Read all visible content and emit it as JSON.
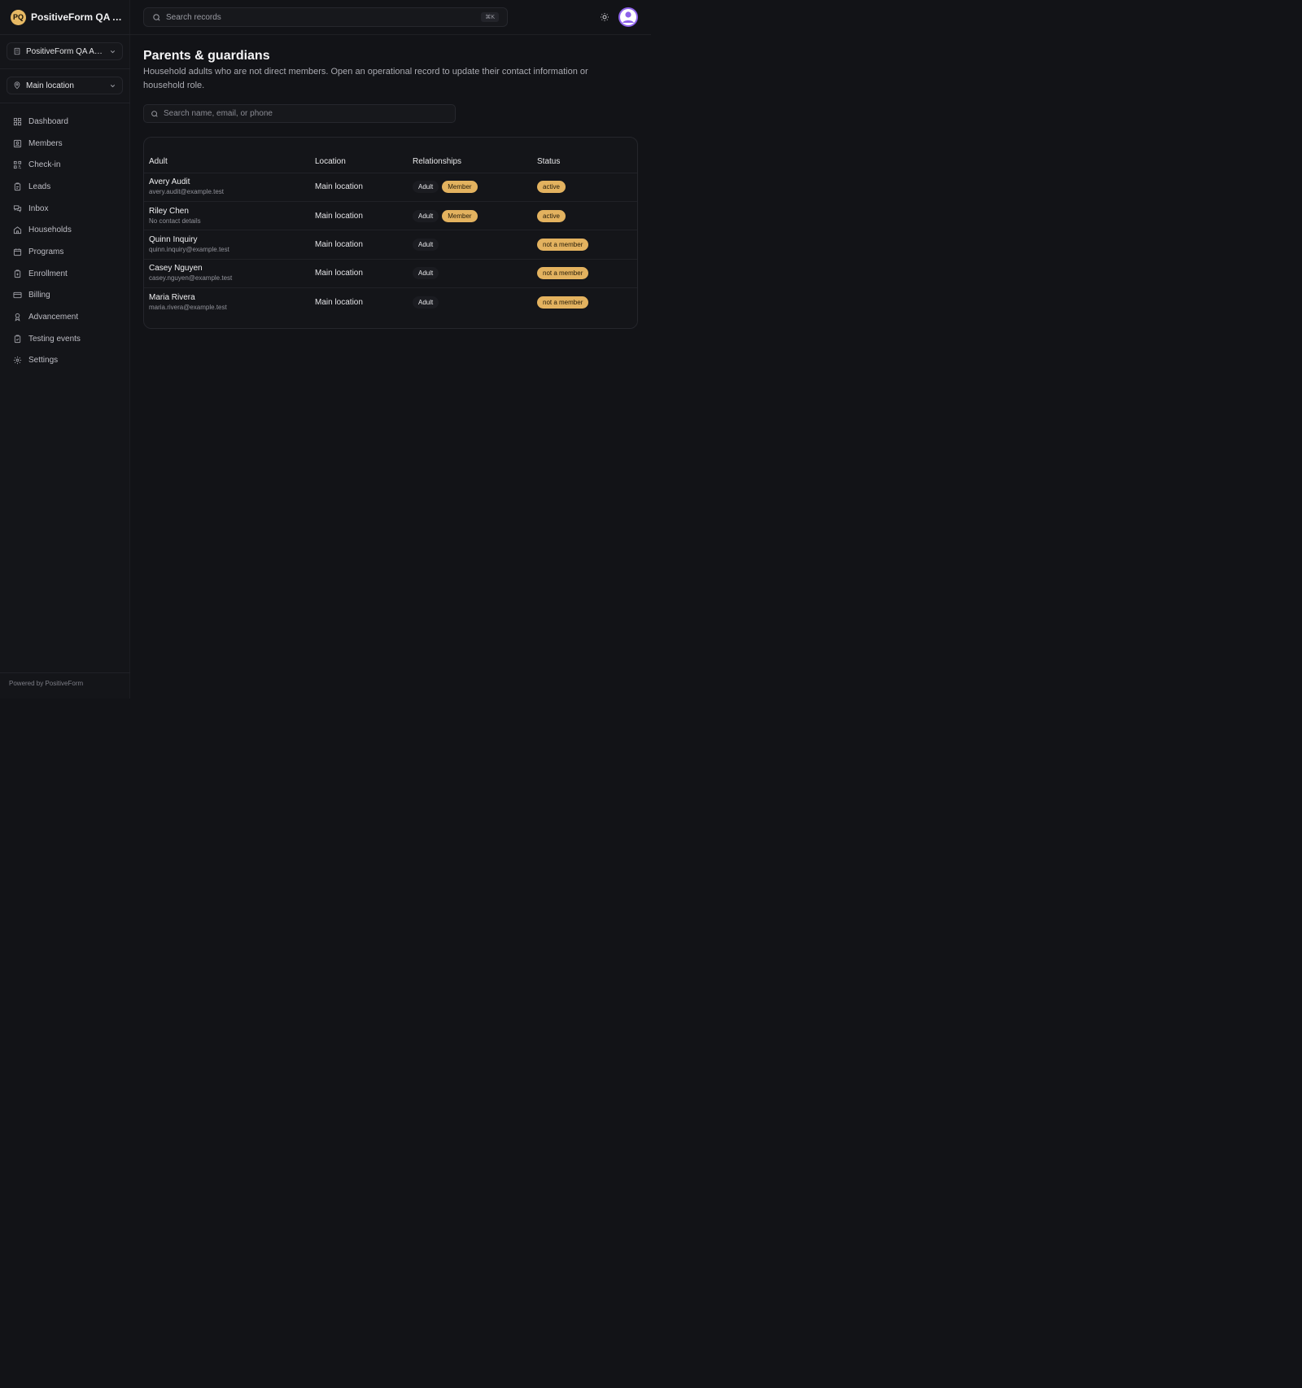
{
  "brand": {
    "initials": "PQ",
    "name": "PositiveForm QA A..."
  },
  "org_picker": {
    "label": "PositiveForm QA Au..."
  },
  "location_picker": {
    "label": "Main location"
  },
  "nav": [
    {
      "label": "Dashboard",
      "icon": "dashboard-icon"
    },
    {
      "label": "Members",
      "icon": "members-icon"
    },
    {
      "label": "Check-in",
      "icon": "checkin-icon"
    },
    {
      "label": "Leads",
      "icon": "leads-icon"
    },
    {
      "label": "Inbox",
      "icon": "inbox-icon"
    },
    {
      "label": "Households",
      "icon": "home-icon"
    },
    {
      "label": "Programs",
      "icon": "calendar-icon"
    },
    {
      "label": "Enrollment",
      "icon": "clipboard-icon"
    },
    {
      "label": "Billing",
      "icon": "credit-card-icon"
    },
    {
      "label": "Advancement",
      "icon": "award-icon"
    },
    {
      "label": "Testing events",
      "icon": "clipboard-check-icon"
    },
    {
      "label": "Settings",
      "icon": "gear-icon"
    }
  ],
  "footer": {
    "text": "Powered by PositiveForm"
  },
  "topbar": {
    "search_placeholder": "Search records",
    "shortcut": "⌘K"
  },
  "page": {
    "title": "Parents & guardians",
    "description": "Household adults who are not direct members. Open an operational record to update their contact information or household role."
  },
  "filter": {
    "placeholder": "Search name, email, or phone"
  },
  "table": {
    "headers": [
      "Adult",
      "Location",
      "Relationships",
      "Status"
    ],
    "rows": [
      {
        "name": "Avery Audit",
        "contact": "avery.audit@example.test",
        "location": "Main location",
        "relationships": [
          "Adult",
          "Member"
        ],
        "status": "active"
      },
      {
        "name": "Riley Chen",
        "contact": "No contact details",
        "location": "Main location",
        "relationships": [
          "Adult",
          "Member"
        ],
        "status": "active"
      },
      {
        "name": "Quinn Inquiry",
        "contact": "quinn.inquiry@example.test",
        "location": "Main location",
        "relationships": [
          "Adult"
        ],
        "status": "not a member"
      },
      {
        "name": "Casey Nguyen",
        "contact": "casey.nguyen@example.test",
        "location": "Main location",
        "relationships": [
          "Adult"
        ],
        "status": "not a member"
      },
      {
        "name": "Maria Rivera",
        "contact": "maria.rivera@example.test",
        "location": "Main location",
        "relationships": [
          "Adult"
        ],
        "status": "not a member"
      }
    ]
  },
  "colors": {
    "background": "#121317",
    "accent": "#e3b25f",
    "avatar": "#8e63ea"
  }
}
